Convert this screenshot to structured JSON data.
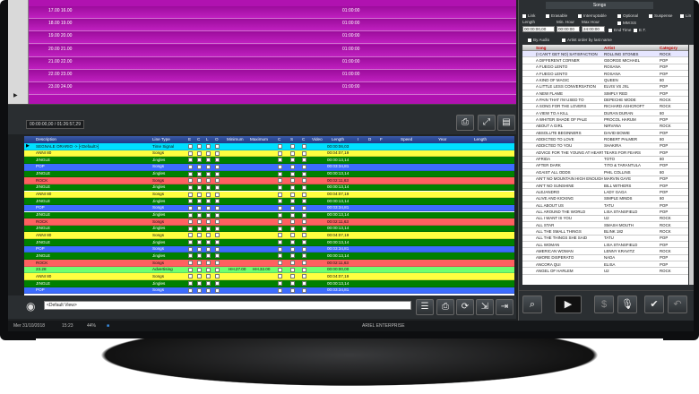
{
  "schedule": {
    "rows": [
      {
        "time": "17.00 16.00",
        "dur": "01:00:00"
      },
      {
        "time": "18.00 19.00",
        "dur": "01:00:00"
      },
      {
        "time": "19.00 20.00",
        "dur": "01:00:00"
      },
      {
        "time": "20.00 21.00",
        "dur": "01:00:00"
      },
      {
        "time": "21.00 22.00",
        "dur": "01:00:00"
      },
      {
        "time": "22.00 23.00",
        "dur": "01:00:00"
      },
      {
        "time": "23.00 24.00",
        "dur": "01:00:00"
      }
    ],
    "marker": "▶"
  },
  "timecode": "00:00:00,00 / 01:26:57,29",
  "grid": {
    "headers": {
      "description": "Description",
      "line_type": "Line Type",
      "e": "E",
      "c": "C",
      "l": "L",
      "o": "O",
      "minimum": "Minimum",
      "maximum": "Maximum",
      "c2": "C",
      "s": "S",
      "c3": "C",
      "video": "Video",
      "length": "Length",
      "i": "I",
      "d": "D",
      "f": "F",
      "speed": "Speed",
      "year": "Year",
      "length2": "Length"
    },
    "rows": [
      {
        "desc": "SEGNALE ORARIO -> [<Default>]",
        "type": "Time Signal",
        "len": "00:00:06,03",
        "min": "",
        "max": "",
        "bg": "#00e0ff"
      },
      {
        "desc": "ANNI 80",
        "type": "Songs",
        "len": "00:04:07,19",
        "min": "",
        "max": "",
        "bg": "#ffff40"
      },
      {
        "desc": "JINGLE",
        "type": "Jingles",
        "len": "00:00:13,14",
        "min": "",
        "max": "",
        "bg": "#008000"
      },
      {
        "desc": "POP",
        "type": "Songs",
        "len": "00:03:34,81",
        "min": "",
        "max": "",
        "bg": "#3c6cff"
      },
      {
        "desc": "JINGLE",
        "type": "Jingles",
        "len": "00:00:13,14",
        "min": "",
        "max": "",
        "bg": "#008000"
      },
      {
        "desc": "ROCK",
        "type": "Songs",
        "len": "00:02:11,63",
        "min": "",
        "max": "",
        "bg": "#ff6060"
      },
      {
        "desc": "JINGLE",
        "type": "Jingles",
        "len": "00:00:13,14",
        "min": "",
        "max": "",
        "bg": "#008000"
      },
      {
        "desc": "ANNI 80",
        "type": "Songs",
        "len": "00:04:07,19",
        "min": "",
        "max": "",
        "bg": "#ffff40"
      },
      {
        "desc": "JINGLE",
        "type": "Jingles",
        "len": "00:00:13,14",
        "min": "",
        "max": "",
        "bg": "#008000"
      },
      {
        "desc": "POP",
        "type": "Songs",
        "len": "00:03:34,81",
        "min": "",
        "max": "",
        "bg": "#3c6cff"
      },
      {
        "desc": "JINGLE",
        "type": "Jingles",
        "len": "00:00:13,14",
        "min": "",
        "max": "",
        "bg": "#008000"
      },
      {
        "desc": "ROCK",
        "type": "Songs",
        "len": "00:02:11,63",
        "min": "",
        "max": "",
        "bg": "#ff6060"
      },
      {
        "desc": "JINGLE",
        "type": "Jingles",
        "len": "00:00:13,14",
        "min": "",
        "max": "",
        "bg": "#008000"
      },
      {
        "desc": "ANNI 80",
        "type": "Songs",
        "len": "00:04:07,19",
        "min": "",
        "max": "",
        "bg": "#ffff40"
      },
      {
        "desc": "JINGLE",
        "type": "Jingles",
        "len": "00:00:13,14",
        "min": "",
        "max": "",
        "bg": "#008000"
      },
      {
        "desc": "POP",
        "type": "Songs",
        "len": "00:03:34,81",
        "min": "",
        "max": "",
        "bg": "#3c6cff"
      },
      {
        "desc": "JINGLE",
        "type": "Jingles",
        "len": "00:00:13,14",
        "min": "",
        "max": "",
        "bg": "#008000"
      },
      {
        "desc": "ROCK",
        "type": "Songs",
        "len": "00:02:11,63",
        "min": "",
        "max": "",
        "bg": "#ff6060"
      },
      {
        "desc": "23.28",
        "type": "Advertising",
        "len": "00:00:00,00",
        "min": "HH.27.00",
        "max": "HH.32.00",
        "bg": "#70ff70"
      },
      {
        "desc": "ANNI 80",
        "type": "Songs",
        "len": "00:04:07,19",
        "min": "",
        "max": "",
        "bg": "#ffff40"
      },
      {
        "desc": "JINGLE",
        "type": "Jingles",
        "len": "00:00:13,14",
        "min": "",
        "max": "",
        "bg": "#008000"
      },
      {
        "desc": "POP",
        "type": "Songs",
        "len": "00:03:34,81",
        "min": "",
        "max": "",
        "bg": "#3c6cff"
      }
    ]
  },
  "view_selector": "<Default View>",
  "taskbar": {
    "date": "Mer 31/10/2018",
    "time": "15:23",
    "battery": "44%",
    "app": "ARIEL ENTERPRISE"
  },
  "songs": {
    "title": "Songs",
    "options": [
      "Link",
      "Erasable",
      "Interruptable",
      "Optional",
      "Suspense",
      "Lin"
    ],
    "labels": {
      "length": "Length",
      "min_hour": "Min. Hour",
      "max_hour": "Max Hour",
      "mm_ss": "MM:SS",
      "end_time": "End Time",
      "et": "E.T."
    },
    "values": {
      "length": "00:00:00,00",
      "min_hour": "00:00:00",
      "max_hour": "24:00:00"
    },
    "sort_options": [
      "By Audio",
      "Artist order by last name"
    ],
    "headers": {
      "song": "Song",
      "artist": "Artist",
      "category": "Category"
    },
    "rows": [
      [
        "(I CAN'T GET NO) SATISFACTION",
        "ROLLING STONES",
        "ROCK"
      ],
      [
        "A DIFFERENT CORNER",
        "GEORGE MICHAEL",
        "POP"
      ],
      [
        "A FUEGO LENTO",
        "ROSANA",
        "POP"
      ],
      [
        "A FUEGO LENTO",
        "ROSANA",
        "POP"
      ],
      [
        "A KIND OF MAGIC",
        "QUEEN",
        "80"
      ],
      [
        "A LITTLE LESS CONVERSATION",
        "ELVIS VS JXL",
        "POP"
      ],
      [
        "A NEW FLAME",
        "SIMPLY RED",
        "POP"
      ],
      [
        "A PAIN THAT I'M USED TO",
        "DEPECHE MODE",
        "ROCK"
      ],
      [
        "A SONG FOR THE LOVERS",
        "RICHARD ASHCROFT",
        "ROCK"
      ],
      [
        "A VIEW TO A KILL",
        "DURAN DURAN",
        "80"
      ],
      [
        "A WHITER SHADE OF PALE",
        "PROCOL HARUM",
        "POP"
      ],
      [
        "ABOUT A GIRL",
        "NIRVANA",
        "ROCK"
      ],
      [
        "ABSOLUTE BEGINNERS",
        "DAVID BOWIE",
        "POP"
      ],
      [
        "ADDICTED TO LOVE",
        "ROBERT PALMER",
        "80"
      ],
      [
        "ADDICTED TO YOU",
        "SHAKIRA",
        "POP"
      ],
      [
        "ADVICE FOR THE YOUNG AT HEART",
        "TEARS FOR FEARS",
        "POP"
      ],
      [
        "AFRIDA",
        "TOTO",
        "80"
      ],
      [
        "AFTER DARK",
        "TITO & TARANTULA",
        "POP"
      ],
      [
        "AGAIST ALL ODDS",
        "PHIL COLLINS",
        "80"
      ],
      [
        "AIN'T NO MOUNTAIN HIGH ENOUGH",
        "MARVIN GAYE",
        "POP"
      ],
      [
        "AIN'T NO SUNSHINE",
        "BILL WITHERS",
        "POP"
      ],
      [
        "ALEJANDRO",
        "LADY GAGA",
        "POP"
      ],
      [
        "ALIVE AND KICKING",
        "SIMPLE MINDS",
        "80"
      ],
      [
        "ALL ABOUT US",
        "TATU",
        "POP"
      ],
      [
        "ALL AROUND THE WORLD",
        "LISA STANSFIELD",
        "POP"
      ],
      [
        "ALL I WANT IS YOU",
        "U2",
        "ROCK"
      ],
      [
        "ALL STAR",
        "SMASH MOUTH",
        "ROCK"
      ],
      [
        "ALL THE SMALL THINGS",
        "BLINK 182",
        "ROCK"
      ],
      [
        "ALL THE THINGS SHE SAID",
        "TATU",
        "POP"
      ],
      [
        "ALL WOMAN",
        "LISA STANSFIELD",
        "POP"
      ],
      [
        "AMERICAN WOMAN",
        "LENNY KRAVITZ",
        "ROCK"
      ],
      [
        "AMORE DISPERATO",
        "NADA",
        "POP"
      ],
      [
        "ANCORA QUI",
        "ELISA",
        "POP"
      ],
      [
        "ANGEL OF HARLEM",
        "U2",
        "ROCK"
      ]
    ]
  },
  "icons": [
    "printer-icon",
    "resize-icon",
    "doc-settings-icon",
    "eye-icon",
    "list-edit-icon",
    "refresh-icon",
    "export-icon",
    "exit-icon",
    "search-icon",
    "play-icon",
    "dollar-icon",
    "mic-icon",
    "check-icon",
    "undo-icon"
  ]
}
